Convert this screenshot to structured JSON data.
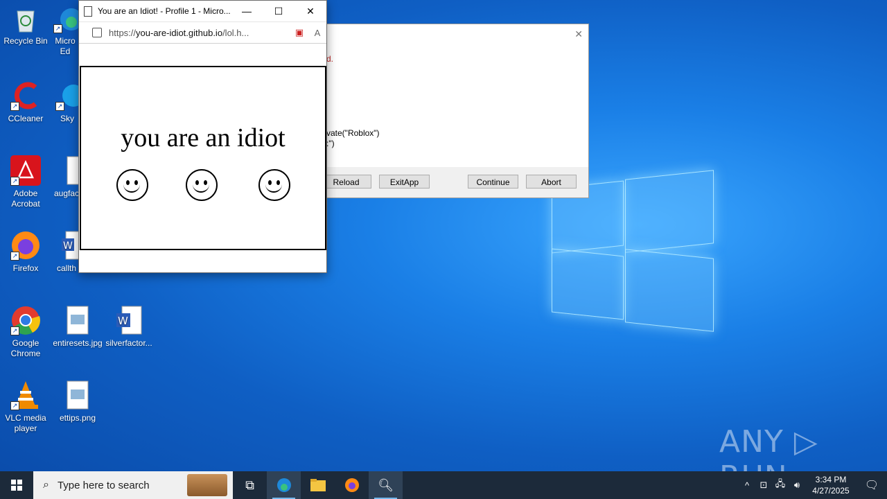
{
  "desktop": {
    "icons": [
      {
        "label": "Recycle Bin"
      },
      {
        "label": "Micro Ed"
      },
      {
        "label": "CCleaner"
      },
      {
        "label": "Sky"
      },
      {
        "label": "Adobe Acrobat"
      },
      {
        "label": "augfac"
      },
      {
        "label": "Firefox"
      },
      {
        "label": "callth"
      },
      {
        "label": "Google Chrome"
      },
      {
        "label": "entiresets.jpg"
      },
      {
        "label": "silverfactor..."
      },
      {
        "label": "VLC media player"
      },
      {
        "label": "ettips.png"
      }
    ]
  },
  "browser": {
    "title": "You are an Idiot! - Profile 1 - Micro...",
    "url_prefix": "https://",
    "url_domain": "you-are-idiot.github.io",
    "url_path": "/lol.h...",
    "page_text": "you are an idiot",
    "controls": {
      "minimize": "—",
      "maximize": "☐",
      "close": "✕"
    }
  },
  "dialog": {
    "error_fragment": "d.",
    "code_line1": "vate(\"Roblox\")",
    "code_line2": ":\")",
    "buttons": {
      "reload": "Reload",
      "exitapp": "ExitApp",
      "continue": "Continue",
      "abort": "Abort"
    }
  },
  "taskbar": {
    "search_placeholder": "Type here to search",
    "time": "3:34 PM",
    "date": "4/27/2025"
  },
  "watermark": "ANY ▷ RUN",
  "colors": {
    "accent": "#0078d7",
    "taskbar": "#1c2a3a"
  }
}
